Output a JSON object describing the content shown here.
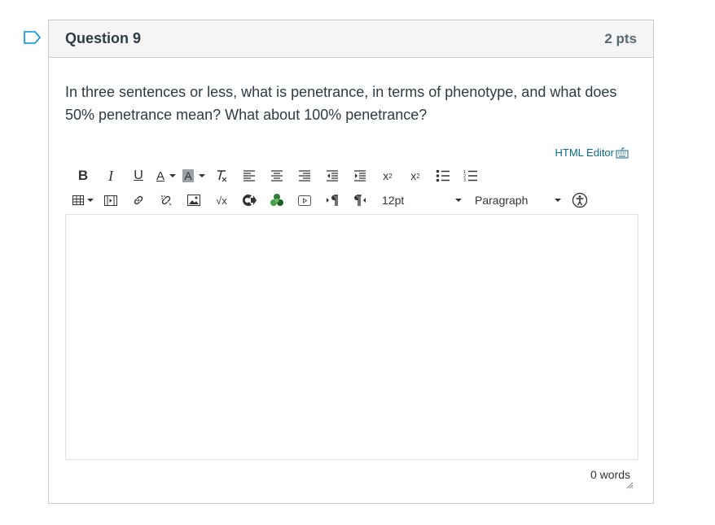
{
  "question": {
    "title": "Question 9",
    "points": "2 pts",
    "text": "In three sentences or less, what is penetrance, in terms of phenotype, and what does 50% penetrance mean? What about 100% penetrance?"
  },
  "editor": {
    "html_editor_label": "HTML Editor",
    "font_size": "12pt",
    "block_format": "Paragraph",
    "word_count": "0 words",
    "content": ""
  },
  "toolbar_row1": [
    "bold-icon",
    "italic-icon",
    "underline-icon",
    "text-color-icon",
    "background-color-icon",
    "clear-formatting-icon",
    "align-left-icon",
    "align-center-icon",
    "align-right-icon",
    "outdent-icon",
    "indent-icon",
    "superscript-icon",
    "subscript-icon",
    "bullet-list-icon",
    "numbered-list-icon"
  ],
  "toolbar_row2": [
    "table-icon",
    "media-icon",
    "link-icon",
    "unlink-icon",
    "image-icon",
    "equation-icon",
    "lti-tools-icon",
    "office-365-icon",
    "record-media-icon",
    "ltr-icon",
    "rtl-icon",
    "font-size-select",
    "block-format-select",
    "accessibility-checker-icon"
  ],
  "colors": {
    "accent": "#008ee2",
    "link": "#0b6b8e",
    "border": "#c7cdd1",
    "header_bg": "#f5f5f5"
  }
}
